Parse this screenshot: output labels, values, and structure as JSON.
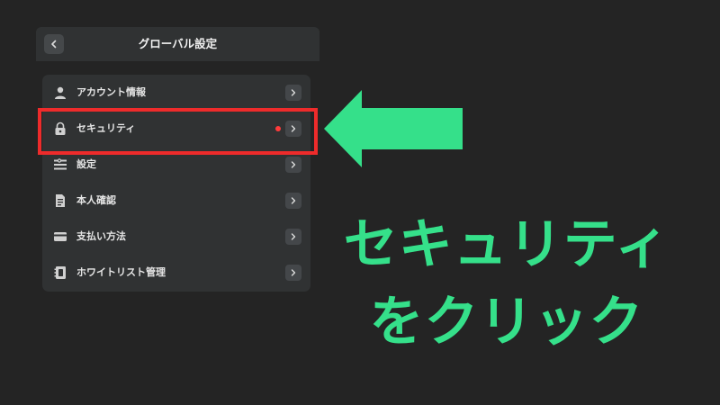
{
  "header": {
    "title": "グローバル設定"
  },
  "menu": {
    "items": [
      {
        "label": "アカウント情報",
        "icon": "user-icon"
      },
      {
        "label": "セキュリティ",
        "icon": "lock-icon",
        "has_notification": true
      },
      {
        "label": "設定",
        "icon": "settings-icon"
      },
      {
        "label": "本人確認",
        "icon": "id-document-icon"
      },
      {
        "label": "支払い方法",
        "icon": "credit-card-icon"
      },
      {
        "label": "ホワイトリスト管理",
        "icon": "address-book-icon"
      }
    ]
  },
  "annotation": {
    "line1": "セキュリティ",
    "line2": "をクリック",
    "text_color": "#35e08a",
    "arrow_color": "#35e08a",
    "highlight_color": "#ee2b2b"
  },
  "colors": {
    "background": "#242424",
    "panel": "#303233",
    "notification_dot": "#ff3b3b"
  }
}
